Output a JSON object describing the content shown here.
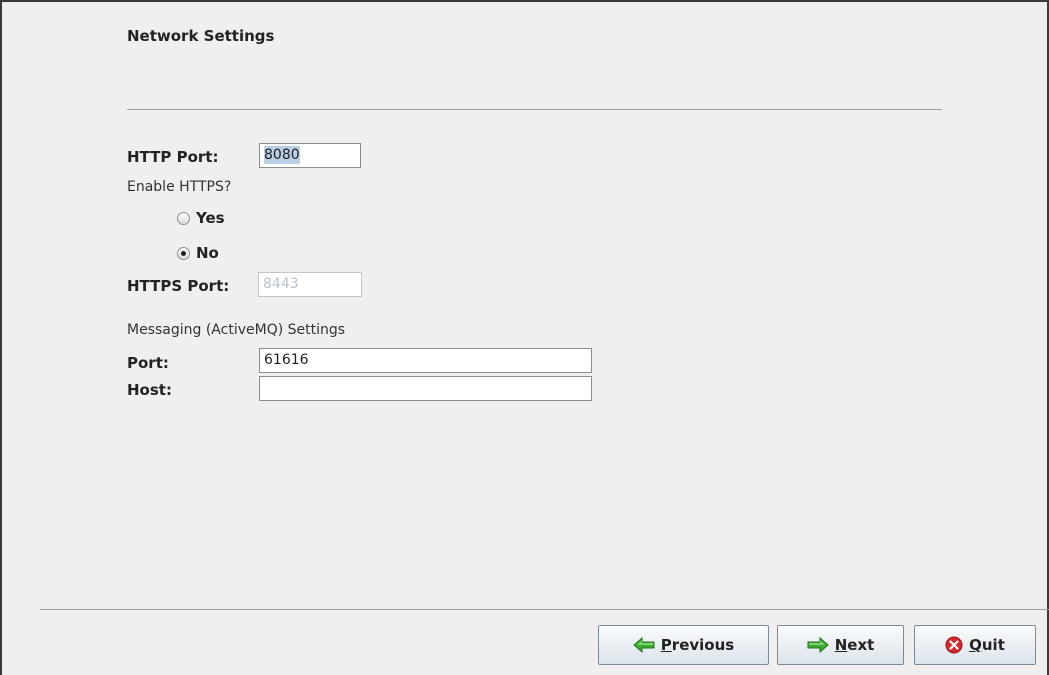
{
  "section": {
    "title": "Network Settings"
  },
  "http": {
    "label": "HTTP Port:",
    "value": "8080"
  },
  "https": {
    "question": "Enable HTTPS?",
    "options": [
      {
        "label": "Yes",
        "selected": false
      },
      {
        "label": "No",
        "selected": true
      }
    ],
    "port_label": "HTTPS Port:",
    "port_value": "8443"
  },
  "messaging": {
    "heading": "Messaging (ActiveMQ) Settings",
    "port_label": "Port:",
    "port_value": "61616",
    "host_label": "Host:",
    "host_value": ""
  },
  "buttons": {
    "previous": {
      "mnemonic": "P",
      "rest": "revious"
    },
    "next": {
      "mnemonic": "N",
      "rest": "ext"
    },
    "quit": {
      "mnemonic": "Q",
      "rest": "uit"
    }
  },
  "colors": {
    "arrow_green": "#3cab2e",
    "quit_red": "#d8272d",
    "selection": "#b8cfe5"
  },
  "icons": {
    "previous": "arrow-left-icon",
    "next": "arrow-right-icon",
    "quit": "close-circle-icon"
  }
}
